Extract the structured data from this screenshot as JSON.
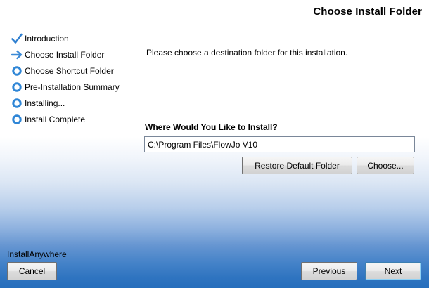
{
  "header": {
    "title": "Choose Install Folder"
  },
  "steps": [
    {
      "label": "Introduction",
      "state": "done",
      "icon": "checkmark-icon"
    },
    {
      "label": "Choose Install Folder",
      "state": "current",
      "icon": "arrow-right-icon"
    },
    {
      "label": "Choose Shortcut Folder",
      "state": "pending",
      "icon": "ring-icon"
    },
    {
      "label": "Pre-Installation Summary",
      "state": "pending",
      "icon": "ring-icon"
    },
    {
      "label": "Installing...",
      "state": "pending",
      "icon": "ring-icon"
    },
    {
      "label": "Install Complete",
      "state": "pending",
      "icon": "ring-icon"
    }
  ],
  "main": {
    "instruction": "Please choose a destination folder for this installation.",
    "where_label": "Where Would You Like to Install?",
    "install_path": "C:\\Program Files\\FlowJo V10",
    "restore_label": "Restore Default Folder",
    "choose_label": "Choose..."
  },
  "footer": {
    "brand": "InstallAnywhere",
    "cancel_label": "Cancel",
    "previous_label": "Previous",
    "next_label": "Next"
  },
  "colors": {
    "check": "#2f7fd0",
    "arrow": "#3b8ad6",
    "ring": "#2f86d6",
    "gradient_bottom": "#266ebc"
  }
}
